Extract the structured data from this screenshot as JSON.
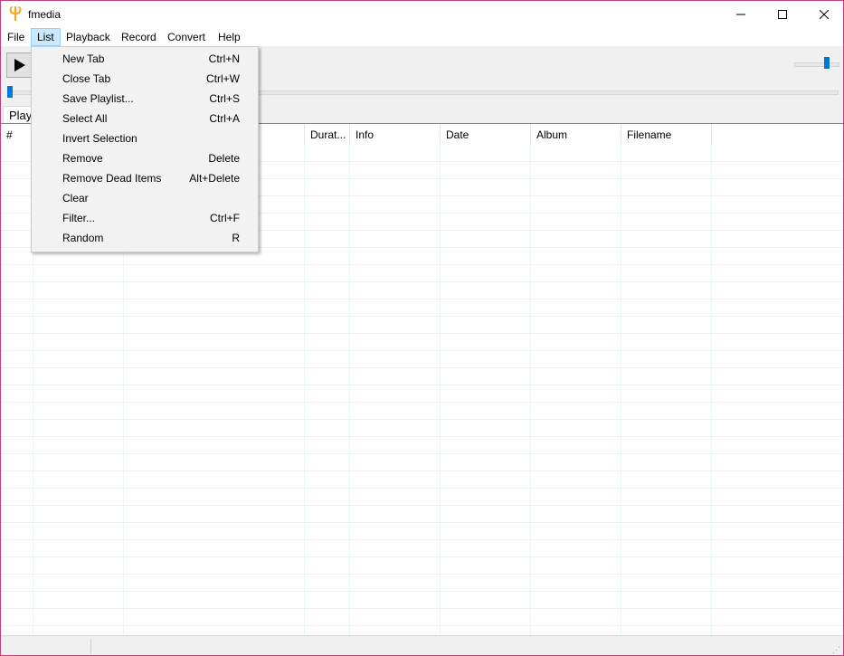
{
  "window": {
    "title": "fmedia"
  },
  "menubar": {
    "items": [
      "File",
      "List",
      "Playback",
      "Record",
      "Convert",
      "Help"
    ]
  },
  "tab": {
    "label": "Play"
  },
  "columns": [
    "#",
    "Durat...",
    "Info",
    "Date",
    "Album",
    "Filename"
  ],
  "list_menu": {
    "items": [
      {
        "label": "New Tab",
        "shortcut": "Ctrl+N"
      },
      {
        "label": "Close Tab",
        "shortcut": "Ctrl+W"
      },
      {
        "label": "Save Playlist...",
        "shortcut": "Ctrl+S"
      },
      {
        "label": "Select All",
        "shortcut": "Ctrl+A"
      },
      {
        "label": "Invert Selection",
        "shortcut": ""
      },
      {
        "label": "Remove",
        "shortcut": "Delete"
      },
      {
        "label": "Remove Dead Items",
        "shortcut": "Alt+Delete"
      },
      {
        "label": "Clear",
        "shortcut": ""
      },
      {
        "label": "Filter...",
        "shortcut": "Ctrl+F"
      },
      {
        "label": "Random",
        "shortcut": "R"
      }
    ]
  },
  "colors": {
    "accent": "#0078d7",
    "menu_highlight": "#cce8ff",
    "window_border": "#c3407a"
  },
  "icons": {
    "app": "fmedia-logo-icon",
    "play": "play-icon"
  }
}
